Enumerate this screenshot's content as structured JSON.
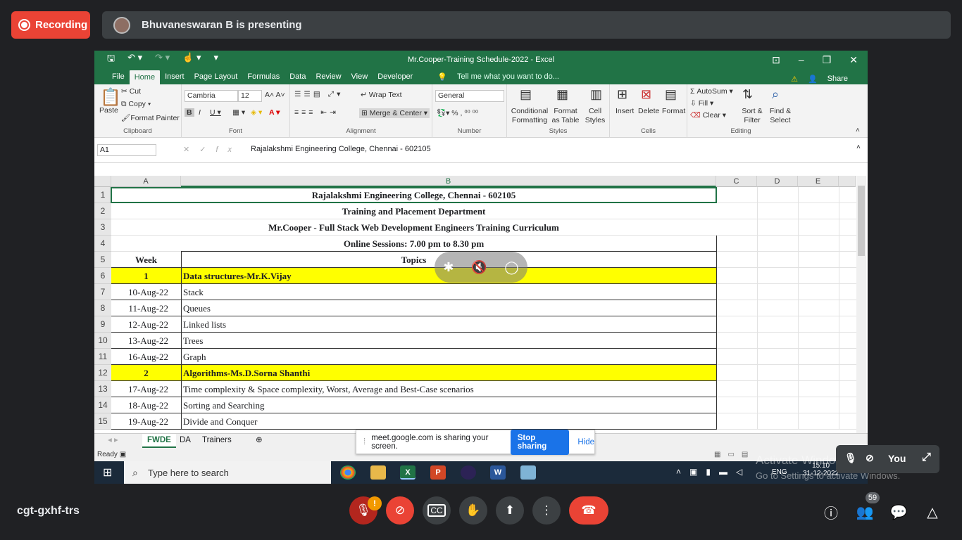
{
  "meet": {
    "recording": "Recording",
    "presenting": "Bhuvaneswaran B is presenting",
    "meeting_code": "cgt-gxhf-trs",
    "participants": "59",
    "you": "You",
    "activate1": "Activate Windows",
    "activate2": "Go to Settings to activate Windows.",
    "sharing_msg": "meet.google.com is sharing your screen.",
    "stop_sharing": "Stop sharing",
    "hide": "Hide"
  },
  "excel": {
    "title": "Mr.Cooper-Training Schedule-2022 - Excel",
    "tabs": [
      "File",
      "Home",
      "Insert",
      "Page Layout",
      "Formulas",
      "Data",
      "Review",
      "View",
      "Developer"
    ],
    "tell_me": "Tell me what you want to do...",
    "share": "Share",
    "ribbon": {
      "paste": "Paste",
      "cut": "Cut",
      "copy": "Copy",
      "format_painter": "Format Painter",
      "clipboard": "Clipboard",
      "font_name": "Cambria",
      "font_size": "12",
      "font": "Font",
      "wrap_text": "Wrap Text",
      "merge_center": "Merge & Center",
      "alignment": "Alignment",
      "number_format": "General",
      "number": "Number",
      "cond_format": "Conditional Formatting",
      "format_table": "Format as Table",
      "cell_styles": "Cell Styles",
      "styles": "Styles",
      "insert": "Insert",
      "delete": "Delete",
      "format": "Format",
      "cells": "Cells",
      "autosum": "AutoSum",
      "fill": "Fill",
      "clear": "Clear",
      "sort_filter": "Sort & Filter",
      "find_select": "Find & Select",
      "editing": "Editing"
    },
    "name_box": "A1",
    "formula": "Rajalakshmi Engineering College, Chennai - 602105",
    "columns": [
      "A",
      "B",
      "C",
      "D",
      "E"
    ],
    "rows": [
      {
        "n": "1",
        "a": "",
        "b": "Rajalakshmi Engineering College, Chennai - 602105"
      },
      {
        "n": "2",
        "a": "",
        "b": "Training and Placement Department"
      },
      {
        "n": "3",
        "a": "",
        "b": "Mr.Cooper - Full Stack Web Development Engineers Training Curriculum"
      },
      {
        "n": "4",
        "a": "",
        "b": "Online Sessions: 7.00 pm to 8.30 pm"
      },
      {
        "n": "5",
        "a": "Week",
        "b": "Topics"
      },
      {
        "n": "6",
        "a": "1",
        "b": "Data structures-Mr.K.Vijay"
      },
      {
        "n": "7",
        "a": "10-Aug-22",
        "b": "Stack"
      },
      {
        "n": "8",
        "a": "11-Aug-22",
        "b": "Queues"
      },
      {
        "n": "9",
        "a": "12-Aug-22",
        "b": "Linked lists"
      },
      {
        "n": "10",
        "a": "13-Aug-22",
        "b": "Trees"
      },
      {
        "n": "11",
        "a": "16-Aug-22",
        "b": "Graph"
      },
      {
        "n": "12",
        "a": "2",
        "b": "Algorithms-Ms.D.Sorna Shanthi"
      },
      {
        "n": "13",
        "a": "17-Aug-22",
        "b": "Time complexity & Space complexity, Worst, Average and Best-Case scenarios"
      },
      {
        "n": "14",
        "a": "18-Aug-22",
        "b": "Sorting and Searching"
      },
      {
        "n": "15",
        "a": "19-Aug-22",
        "b": "Divide and Conquer"
      }
    ],
    "sheets": [
      "FWDE",
      "DA",
      "Trainers"
    ],
    "status": "Ready",
    "taskbar": {
      "search": "Type here to search",
      "lang": "ENG",
      "time": "15:10",
      "date": "31-12-2022"
    }
  }
}
